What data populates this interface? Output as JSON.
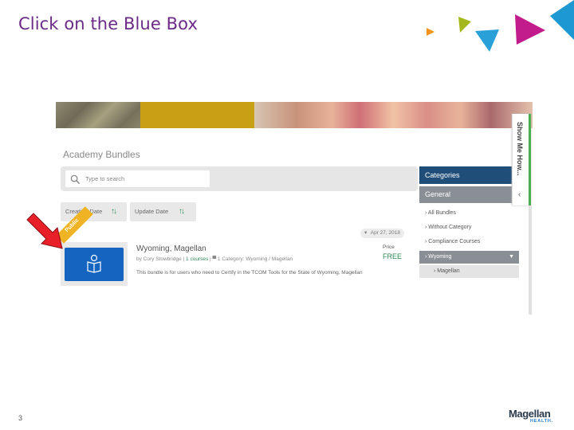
{
  "slide": {
    "title": "Click on the Blue Box",
    "number": "3"
  },
  "screenshot": {
    "panel_title": "Academy Bundles",
    "search": {
      "placeholder": "Type to search"
    },
    "sort_buttons": [
      {
        "label": "Creation Date"
      },
      {
        "label": "Update Date"
      }
    ],
    "bundle": {
      "ribbon": "Public",
      "title": "Wyoming, Magellan",
      "meta_author": "by Cory Stowbridge |",
      "meta_courses": "1 courses",
      "meta_category": "| ▀ 1 Category: Wyoming / Magellan",
      "description": "This bundle is for users who need to Certify in the TCOM Tools for the State of Wyoming, Magellan",
      "date": "Apr 27, 2018",
      "price_label": "Price",
      "price_value": "FREE"
    },
    "sidebar": {
      "header": "Categories",
      "group": "General",
      "items": [
        {
          "label": "All Bundles"
        },
        {
          "label": "Without Category"
        },
        {
          "label": "Compliance Courses"
        },
        {
          "label": "Wyoming"
        },
        {
          "label": "Magellan"
        }
      ]
    },
    "show_me": "Show Me How..."
  },
  "logo": {
    "word": "Magellan",
    "sub": "HEALTH."
  },
  "colors": {
    "title": "#6b2a86",
    "selected_blue": "#1565c0",
    "nav_blue": "#1f4e79",
    "green": "#2e8b57",
    "ribbon": "#f0b323",
    "arrow": "#e8202a"
  }
}
